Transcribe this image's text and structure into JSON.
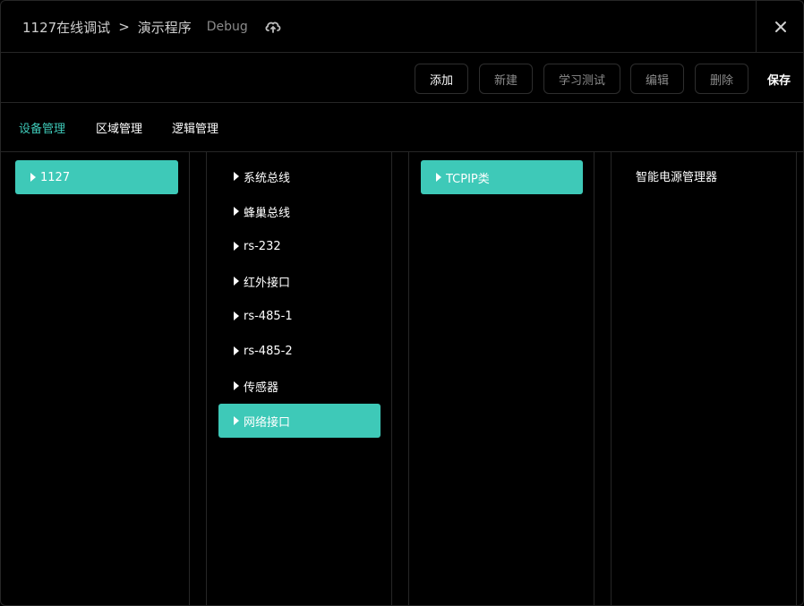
{
  "header": {
    "project": "1127在线调试",
    "separator": ">",
    "program": "演示程序",
    "mode": "Debug",
    "cloud_icon": "cloud-sync-icon",
    "close_icon": "close-icon"
  },
  "toolbar": {
    "buttons": [
      {
        "label": "添加",
        "active": true
      },
      {
        "label": "新建",
        "active": false
      },
      {
        "label": "学习测试",
        "active": false
      },
      {
        "label": "编辑",
        "active": false
      },
      {
        "label": "删除",
        "active": false
      }
    ],
    "save_label": "保存"
  },
  "tabs": [
    {
      "label": "设备管理",
      "selected": true
    },
    {
      "label": "区域管理",
      "selected": false
    },
    {
      "label": "逻辑管理",
      "selected": false
    }
  ],
  "columns": {
    "col1": [
      {
        "label": "1127",
        "selected": true
      }
    ],
    "col2": [
      {
        "label": "系统总线",
        "selected": false
      },
      {
        "label": "蜂巢总线",
        "selected": false
      },
      {
        "label": "rs-232",
        "selected": false
      },
      {
        "label": "红外接口",
        "selected": false
      },
      {
        "label": "rs-485-1",
        "selected": false
      },
      {
        "label": "rs-485-2",
        "selected": false
      },
      {
        "label": "传感器",
        "selected": false
      },
      {
        "label": "网络接口",
        "selected": true
      }
    ],
    "col3": [
      {
        "label": "TCPIP类",
        "selected": true
      }
    ],
    "col4": [
      {
        "label": "智能电源管理器",
        "selected": false
      }
    ]
  },
  "colors": {
    "accent": "#3ec9b8",
    "background": "#000000",
    "border": "#262626"
  }
}
